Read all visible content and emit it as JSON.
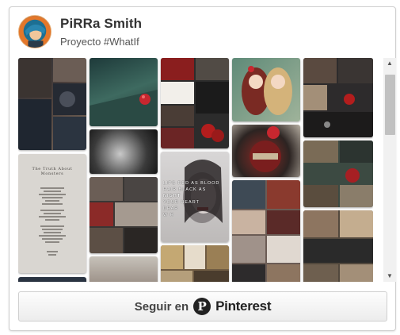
{
  "header": {
    "user_name": "PiRRa Smith",
    "board_name": "Proyecto #WhatIf"
  },
  "pins": [
    {
      "id": "pin-1",
      "colors": [
        "#2a2f38",
        "#5b4b45",
        "#8c7a6c"
      ]
    },
    {
      "id": "pin-2",
      "colors": [
        "#1e3a3a",
        "#3e6a60",
        "#c8272f"
      ]
    },
    {
      "id": "pin-3",
      "colors": [
        "#7a1c1c",
        "#2c2c2c",
        "#b8b2a6"
      ]
    },
    {
      "id": "pin-4",
      "colors": [
        "#5f8a78",
        "#c9a06a",
        "#8a2a25"
      ]
    },
    {
      "id": "pin-5",
      "colors": [
        "#2d2b2c",
        "#5a4a40",
        "#a38f78"
      ]
    },
    {
      "id": "pin-6",
      "colors": [
        "#111",
        "#555",
        "#999"
      ]
    },
    {
      "id": "pin-7",
      "colors": [
        "#3a3735",
        "#7a6f66",
        "#b9afa6"
      ]
    },
    {
      "id": "pin-8",
      "colors": [
        "#2b2b2b",
        "#6b2525",
        "#c7c2ba"
      ]
    },
    {
      "id": "pin-9",
      "colors": [
        "#52483d",
        "#8d7560",
        "#c4ad8f"
      ]
    },
    {
      "id": "pin-10",
      "colors": [
        "#3c4a42",
        "#7a6b56",
        "#a61f23"
      ]
    },
    {
      "id": "pin-11",
      "colors": [
        "#7b1e1e",
        "#c98c6c",
        "#2c2724"
      ]
    },
    {
      "id": "pin-12",
      "colors": [
        "#b59f7b",
        "#705c43",
        "#d9c9a9"
      ]
    },
    {
      "id": "pin-13",
      "colors": [
        "#3e4a55",
        "#8a5a4e",
        "#c9b3a1"
      ]
    },
    {
      "id": "pin-14",
      "colors": [
        "#2a3442",
        "#4b5a6a",
        "#8a8f99"
      ]
    },
    {
      "id": "pin-15",
      "colors": [
        "#6b5c55",
        "#a0928a",
        "#e0d8d0"
      ]
    }
  ],
  "poem": {
    "title": "The Truth About Monsters"
  },
  "night_card": {
    "lines": [
      "LIPS RED AS BLOOD",
      "HAIR BLACK AS",
      "NIGHT",
      "YOUR HEART",
      "DEAR",
      "W H"
    ]
  },
  "scrollbar": {
    "up_icon": "arrow-up-icon",
    "down_icon": "arrow-down-icon"
  },
  "follow_button": {
    "label": "Seguir en",
    "brand_glyph": "P",
    "brand": "Pinterest"
  }
}
